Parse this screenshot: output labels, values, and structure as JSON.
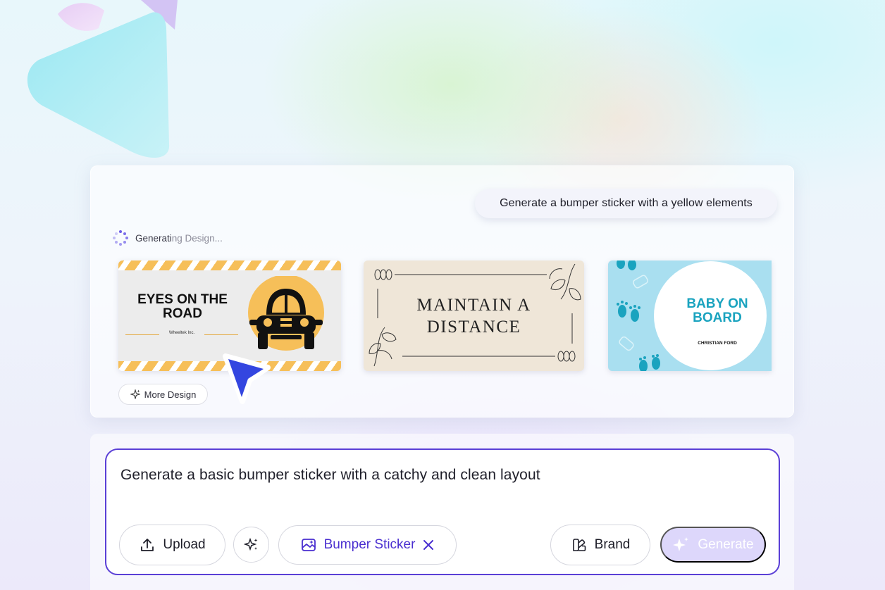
{
  "chat": {
    "user_prompt": "Generate a bumper sticker with a yellow elements",
    "status_prefix": "Generati",
    "status_suffix": "ng Design..."
  },
  "designs": [
    {
      "title_line1": "EYES ON THE",
      "title_line2": "ROAD",
      "subtitle": "Wheeltek Inc."
    },
    {
      "title_line1": "MAINTAIN A",
      "title_line2": "DISTANCE"
    },
    {
      "title_line1": "BABY ON",
      "title_line2": "BOARD",
      "subtitle": "CHRISTIAN FORD"
    }
  ],
  "more_design_label": "More Design",
  "composer": {
    "prompt_text": "Generate a basic bumper sticker with a catchy and clean layout",
    "upload_label": "Upload",
    "tag_label": "Bumper Sticker",
    "brand_label": "Brand",
    "generate_label": "Generate"
  },
  "colors": {
    "accent": "#5a3fd6",
    "sticker_yellow": "#f6bf59",
    "baby_teal": "#1aa3bf",
    "generate_disabled": "#ddd7fb"
  },
  "icons": [
    "spinner-icon",
    "sparkle-icon",
    "upload-icon",
    "magic-icon",
    "image-tag-icon",
    "close-icon",
    "brand-icon",
    "cursor-icon"
  ]
}
